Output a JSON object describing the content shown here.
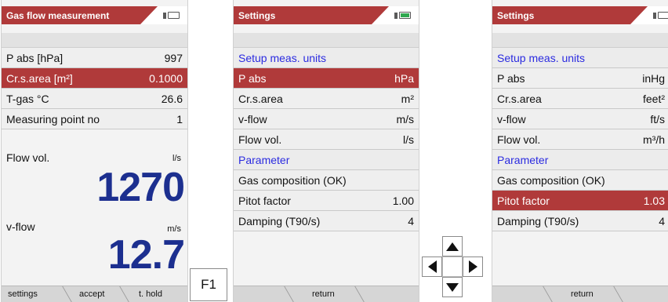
{
  "screen1": {
    "title": "Gas flow measurement",
    "rows": [
      {
        "label": "P abs [hPa]",
        "value": "997"
      },
      {
        "label": "Cr.s.area [m²]",
        "value": "0.1000"
      },
      {
        "label": "T-gas °C",
        "value": "26.6"
      },
      {
        "label": "Measuring point no",
        "value": "1"
      }
    ],
    "flow_vol": {
      "label": "Flow vol.",
      "unit": "l/s",
      "value": "1270"
    },
    "v_flow": {
      "label": "v-flow",
      "unit": "m/s",
      "value": "12.7"
    },
    "softkeys": [
      "settings",
      "accept",
      "t. hold"
    ]
  },
  "f1_label": "F1",
  "screen2": {
    "title": "Settings",
    "section1": "Setup meas. units",
    "rows": [
      {
        "label": "P abs",
        "value": "hPa"
      },
      {
        "label": "Cr.s.area",
        "value": "m²"
      },
      {
        "label": "v-flow",
        "value": "m/s"
      },
      {
        "label": "Flow vol.",
        "value": "l/s"
      }
    ],
    "section2": "Parameter",
    "rows2": [
      {
        "label": "Gas composition (OK)",
        "value": ""
      },
      {
        "label": "Pitot factor",
        "value": "1.00"
      },
      {
        "label": "Damping (T90/s)",
        "value": "4"
      }
    ],
    "softkey": "return"
  },
  "screen3": {
    "title": "Settings",
    "section1": "Setup meas. units",
    "rows": [
      {
        "label": "P abs",
        "value": "inHg"
      },
      {
        "label": "Cr.s.area",
        "value": "feet²"
      },
      {
        "label": "v-flow",
        "value": "ft/s"
      },
      {
        "label": "Flow vol.",
        "value": "m³/h"
      }
    ],
    "section2": "Parameter",
    "rows2": [
      {
        "label": "Gas composition (OK)",
        "value": ""
      },
      {
        "label": "Pitot factor",
        "value": "1.03"
      },
      {
        "label": "Damping (T90/s)",
        "value": "4"
      }
    ],
    "softkey": "return"
  },
  "icons": {
    "battery_partial": "battery-icon",
    "battery_full": "battery-full-icon",
    "arrows": [
      "arrow-up-icon",
      "arrow-left-icon",
      "arrow-right-icon",
      "arrow-down-icon"
    ]
  },
  "colors": {
    "accent": "#b03a3a",
    "section_blue": "#2b2be0",
    "reading_blue": "#1c2f8f",
    "battery_green": "#2fa84f"
  }
}
